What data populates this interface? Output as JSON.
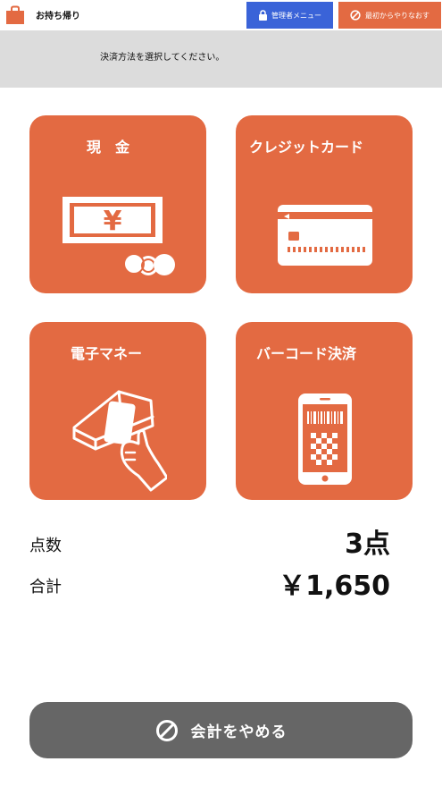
{
  "header": {
    "mode_label": "お持ち帰り",
    "admin_label": "管理者メニュー",
    "restart_label": "最初からやりなおす"
  },
  "banner": {
    "instruction": "決済方法を選択してください。"
  },
  "payment_methods": [
    {
      "label": "現　金",
      "icon": "cash-icon"
    },
    {
      "label": "クレジットカード",
      "icon": "credit-card-icon"
    },
    {
      "label": "電子マネー",
      "icon": "emoney-reader-icon"
    },
    {
      "label": "バーコード決済",
      "icon": "barcode-phone-icon"
    }
  ],
  "cash_symbol": "¥",
  "summary": {
    "count_label": "点数",
    "count_value": "3点",
    "total_label": "合計",
    "total_value": "￥1,650"
  },
  "cancel": {
    "label": "会計をやめる"
  },
  "colors": {
    "accent": "#e36a42",
    "admin": "#3a63d8",
    "banner": "#dcdcdc",
    "cancel": "#666666"
  }
}
